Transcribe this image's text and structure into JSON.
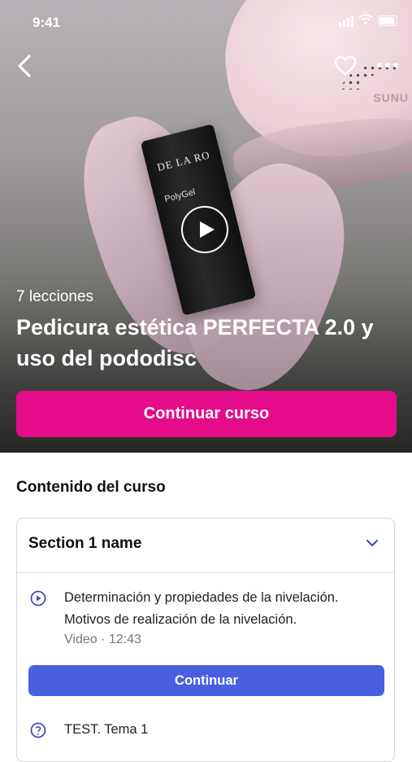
{
  "status_bar": {
    "time": "9:41"
  },
  "hero": {
    "lessons_count": "7 lecciones",
    "title": "Pedicura estética PERFECTA 2.0 y uso del pododisc",
    "product_brand": "DE LA RO",
    "product_name": "PolyGel",
    "lamp_brand": "SUNU",
    "continue_label": "Continuar curso"
  },
  "content": {
    "heading": "Contenido del curso",
    "section": {
      "title": "Section 1 name",
      "lessons": [
        {
          "title": "Determinación y propiedades de la nivelación. Motivos de realización de la nivelación.",
          "type": "Video",
          "duration": "12:43",
          "meta": "Video · 12:43",
          "action_label": "Continuar",
          "icon": "play-circle-icon"
        },
        {
          "title": "TEST. Tema 1",
          "icon": "help-circle-icon"
        }
      ]
    }
  },
  "colors": {
    "accent": "#e40c88",
    "primary_button": "#4a5fe0",
    "icon_blue": "#3d4fbf"
  }
}
